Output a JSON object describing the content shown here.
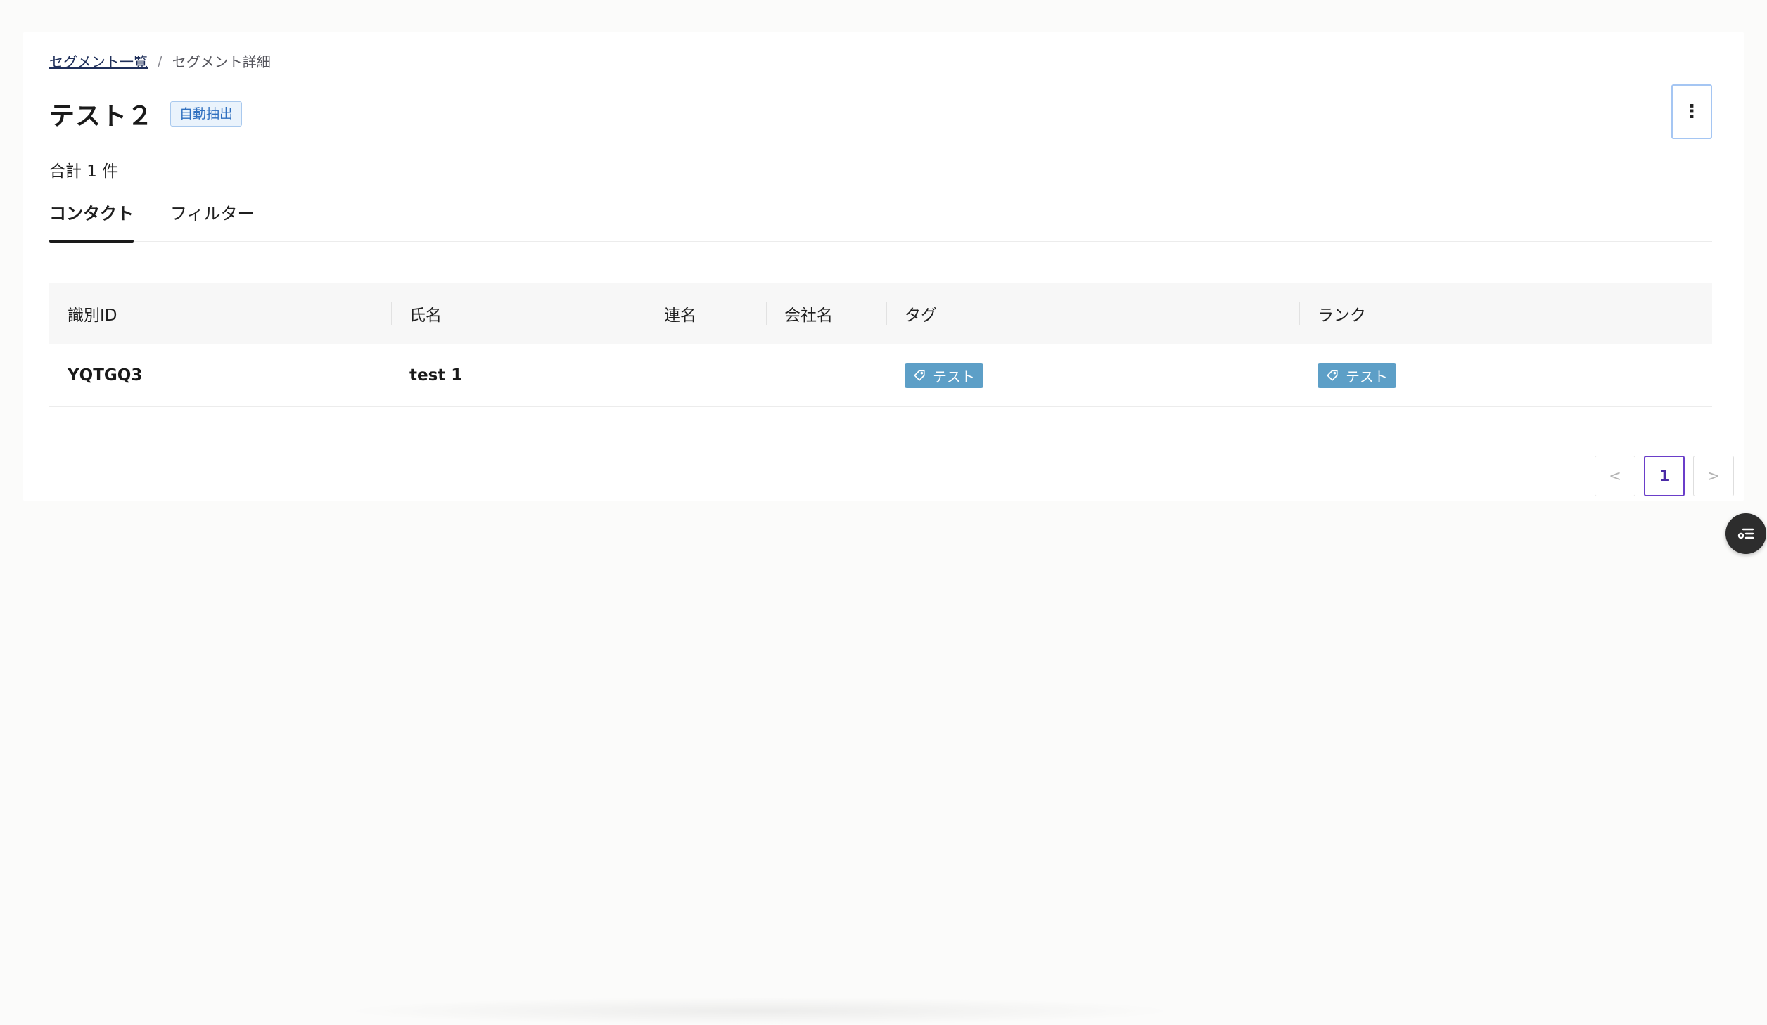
{
  "breadcrumb": {
    "parent": "セグメント一覧",
    "separator": "/",
    "current": "セグメント詳細"
  },
  "segment": {
    "title": "テスト２",
    "badge": "自動抽出",
    "more_icon": "⋮"
  },
  "summary": {
    "total_text": "合計 1 件"
  },
  "tabs": [
    {
      "label": "コンタクト",
      "active": true
    },
    {
      "label": "フィルター",
      "active": false
    }
  ],
  "table": {
    "columns": [
      "識別ID",
      "氏名",
      "連名",
      "会社名",
      "タグ",
      "ランク"
    ],
    "rows": [
      {
        "id": "YQTGQ3",
        "name": "test 1",
        "joint_name": "",
        "company": "",
        "tag": "テスト",
        "rank": "テスト"
      }
    ]
  },
  "pagination": {
    "prev": "<",
    "current_page": "1",
    "next": ">"
  },
  "icons": {
    "tag": "tag-icon",
    "more": "more-vertical-icon",
    "floating": "task-list-icon"
  },
  "colors": {
    "tag_bg": "#5d9fc7",
    "badge_text": "#2f6fbf",
    "page_active": "#6a3ec9"
  }
}
